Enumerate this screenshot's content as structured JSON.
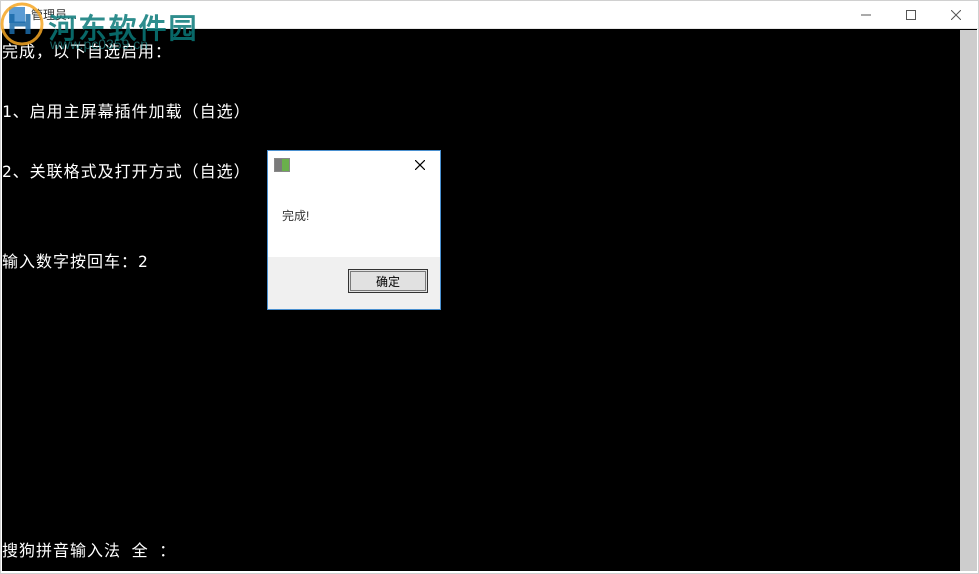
{
  "watermark": {
    "text": "河东软件园",
    "url": "www.pc0359.cn"
  },
  "window": {
    "title": "管理员..."
  },
  "console": {
    "line1": "完成，以下自选启用：",
    "line2": "1、启用主屏幕插件加载（自选）",
    "line3": "2、关联格式及打开方式（自选）",
    "line4": "输入数字按回车：2",
    "bottom": "搜狗拼音输入法 全 ："
  },
  "dialog": {
    "message": "完成!",
    "ok_label": "确定"
  }
}
